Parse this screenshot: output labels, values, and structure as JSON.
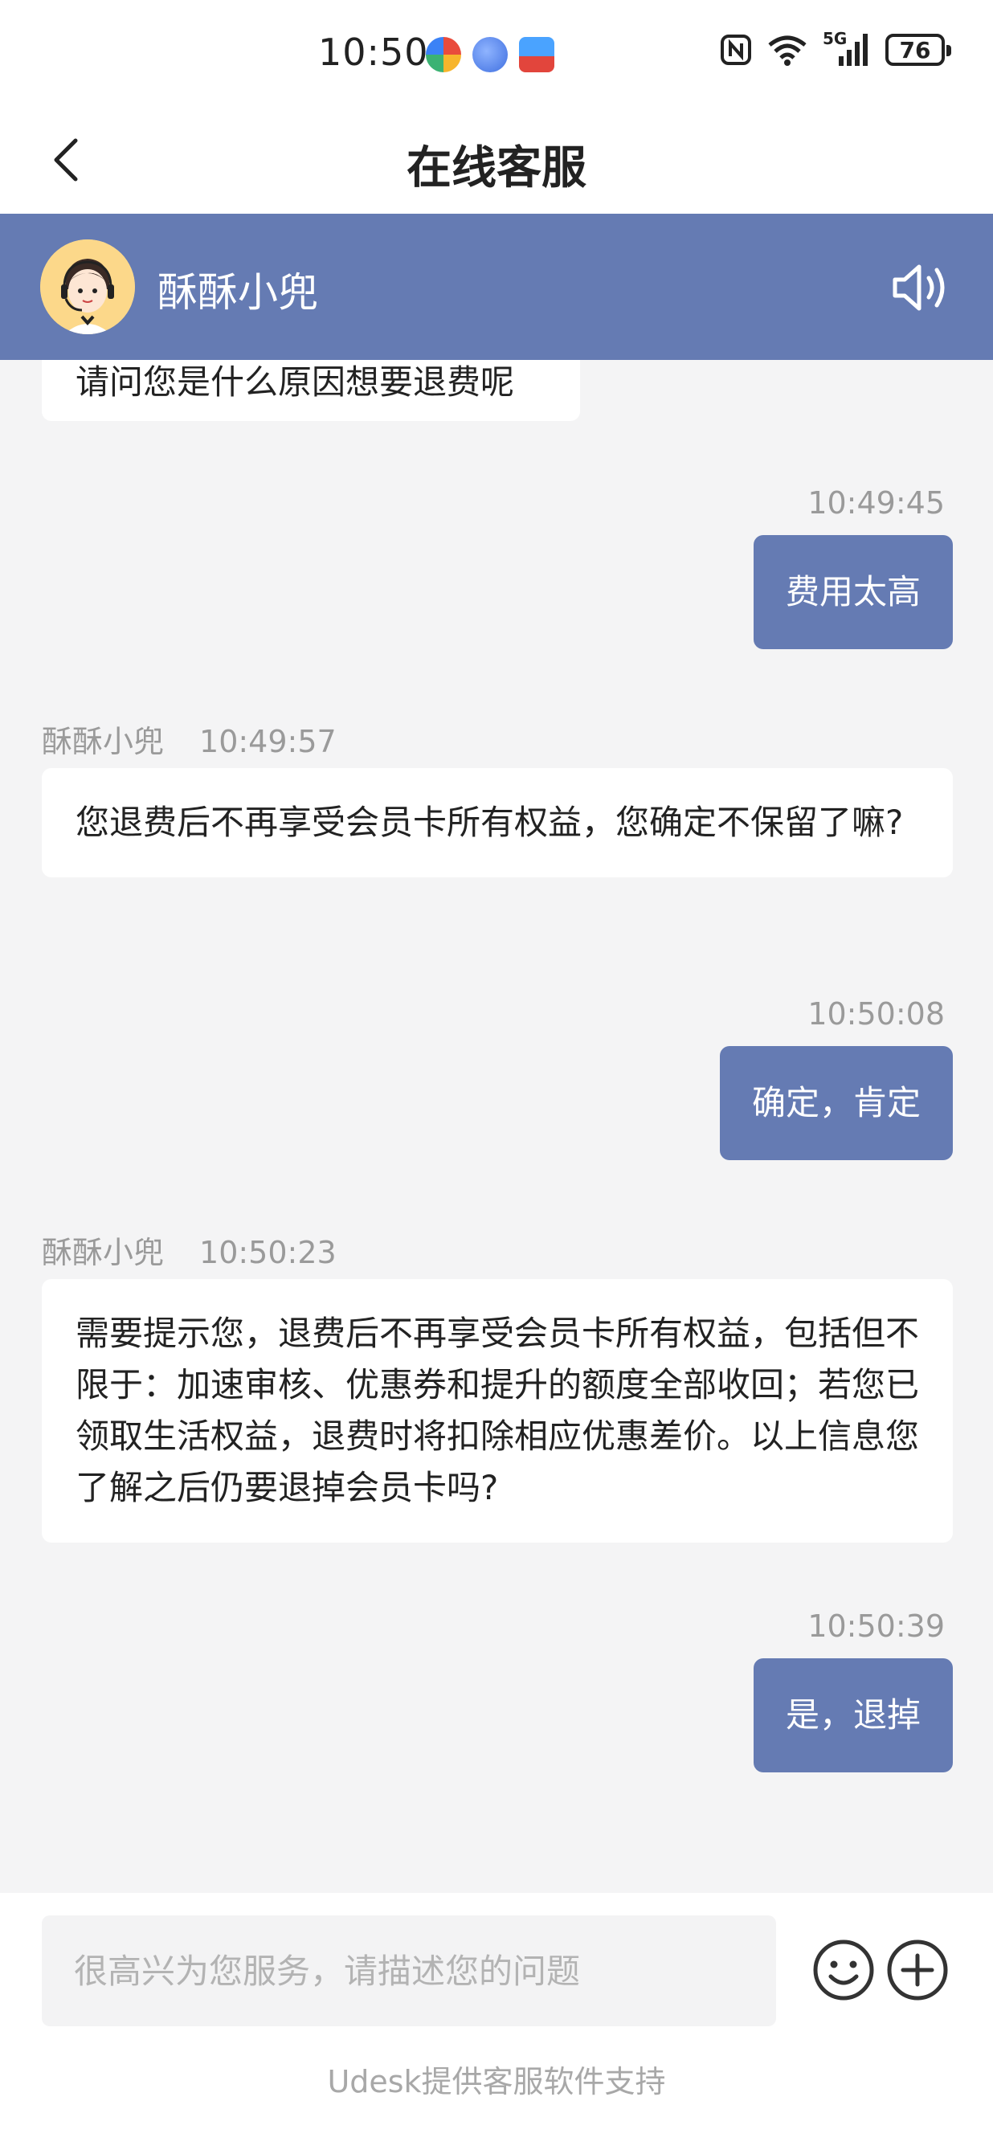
{
  "status_bar": {
    "time": "10:50",
    "battery": "76",
    "network": "5G"
  },
  "nav": {
    "title": "在线客服"
  },
  "agent": {
    "name": "酥酥小兜"
  },
  "messages": [
    {
      "from": "agent",
      "text": "请问您是什么原因想要退费呢"
    },
    {
      "from": "user",
      "time": "10:49:45",
      "text": "费用太高"
    },
    {
      "from": "agent",
      "name": "酥酥小兜",
      "time": "10:49:57",
      "text": "您退费后不再享受会员卡所有权益，您确定不保留了嘛?"
    },
    {
      "from": "user",
      "time": "10:50:08",
      "text": "确定，肯定"
    },
    {
      "from": "agent",
      "name": "酥酥小兜",
      "time": "10:50:23",
      "text": "需要提示您，退费后不再享受会员卡所有权益，包括但不限于：加速审核、优惠券和提升的额度全部收回；若您已领取生活权益，退费时将扣除相应优惠差价。以上信息您了解之后仍要退掉会员卡吗?"
    },
    {
      "from": "user",
      "time": "10:50:39",
      "text": "是，退掉"
    }
  ],
  "input": {
    "placeholder": "很高兴为您服务，请描述您的问题"
  },
  "footer": "Udesk提供客服软件支持",
  "colors": {
    "accent": "#657bb3",
    "background": "#f4f4f5"
  },
  "icons": {
    "back": "chevron-left-icon",
    "speaker": "speaker-icon",
    "emoji": "emoji-icon",
    "plus": "plus-circle-icon"
  }
}
